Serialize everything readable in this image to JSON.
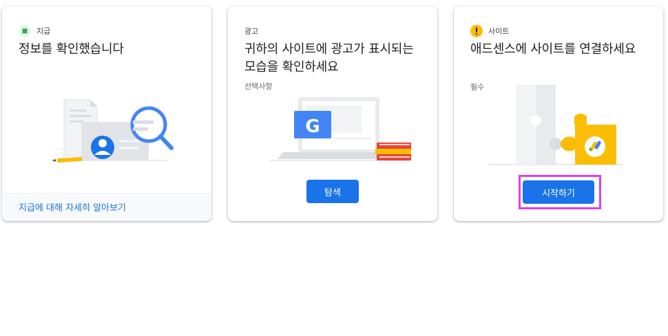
{
  "cards": [
    {
      "status_label": "지급",
      "status_icon": "green-square-icon",
      "title": "정보를 확인했습니다",
      "footer_link": "지급에 대해 자세히 알아보기",
      "illustration": "payment-id-card-magnifier-illustration"
    },
    {
      "status_label": "광고",
      "title": "귀하의 사이트에 광고가 표시되는 모습을 확인하세요",
      "subtitle": "선택사항",
      "button_label": "탐색",
      "illustration": "laptop-google-ad-illustration"
    },
    {
      "status_label": "사이트",
      "status_icon": "warning-icon",
      "title": "애드센스에 사이트를 연결하세요",
      "subtitle": "필수",
      "button_label": "시작하기",
      "illustration": "puzzle-adsense-illustration"
    }
  ],
  "colors": {
    "primary": "#1a73e8",
    "success": "#34a853",
    "warning": "#fbbc04",
    "highlight": "#e03ee8"
  }
}
